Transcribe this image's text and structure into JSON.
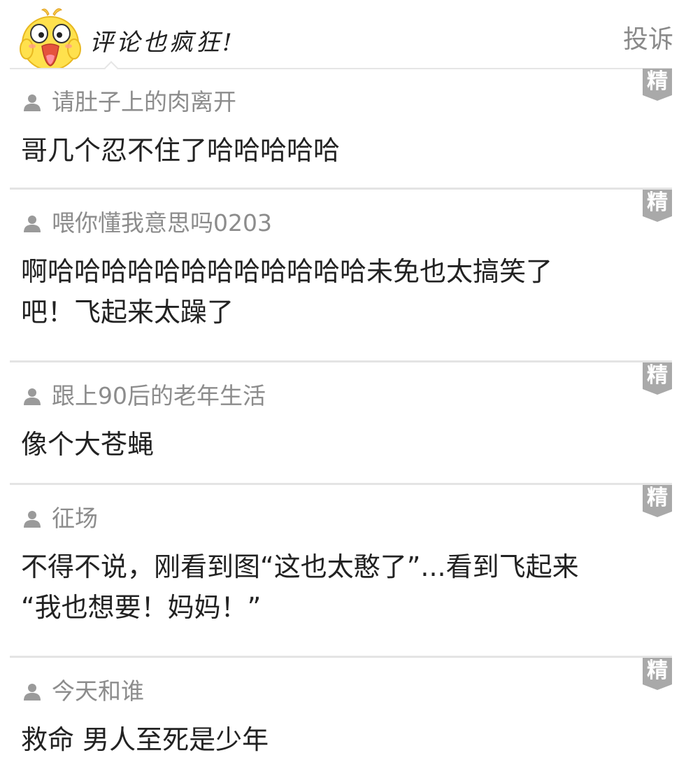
{
  "header": {
    "title": "评论也疯狂!",
    "report_label": "投诉",
    "mascot_icon": "yellow-chick-mascot-icon"
  },
  "badge_label": "精",
  "colors": {
    "badge_bg": "#a9a9a9",
    "username": "#8c8c8c",
    "divider": "#e4e4e4",
    "text": "#222222"
  },
  "comments": [
    {
      "username": "请肚子上的肉离开",
      "lines": [
        "哥几个忍不住了哈哈哈哈哈"
      ]
    },
    {
      "username": "喂你懂我意思吗0203",
      "lines": [
        "啊哈哈哈哈哈哈哈哈哈哈哈哈未免也太搞笑了",
        "吧！飞起来太躁了"
      ]
    },
    {
      "username": "跟上90后的老年生活",
      "lines": [
        "像个大苍蝇"
      ]
    },
    {
      "username": "征场",
      "lines": [
        "不得不说，刚看到图“这也太憨了”...看到飞起来",
        "“我也想要！妈妈！”"
      ]
    },
    {
      "username": "今天和谁",
      "lines": [
        "救命 男人至死是少年"
      ]
    }
  ]
}
